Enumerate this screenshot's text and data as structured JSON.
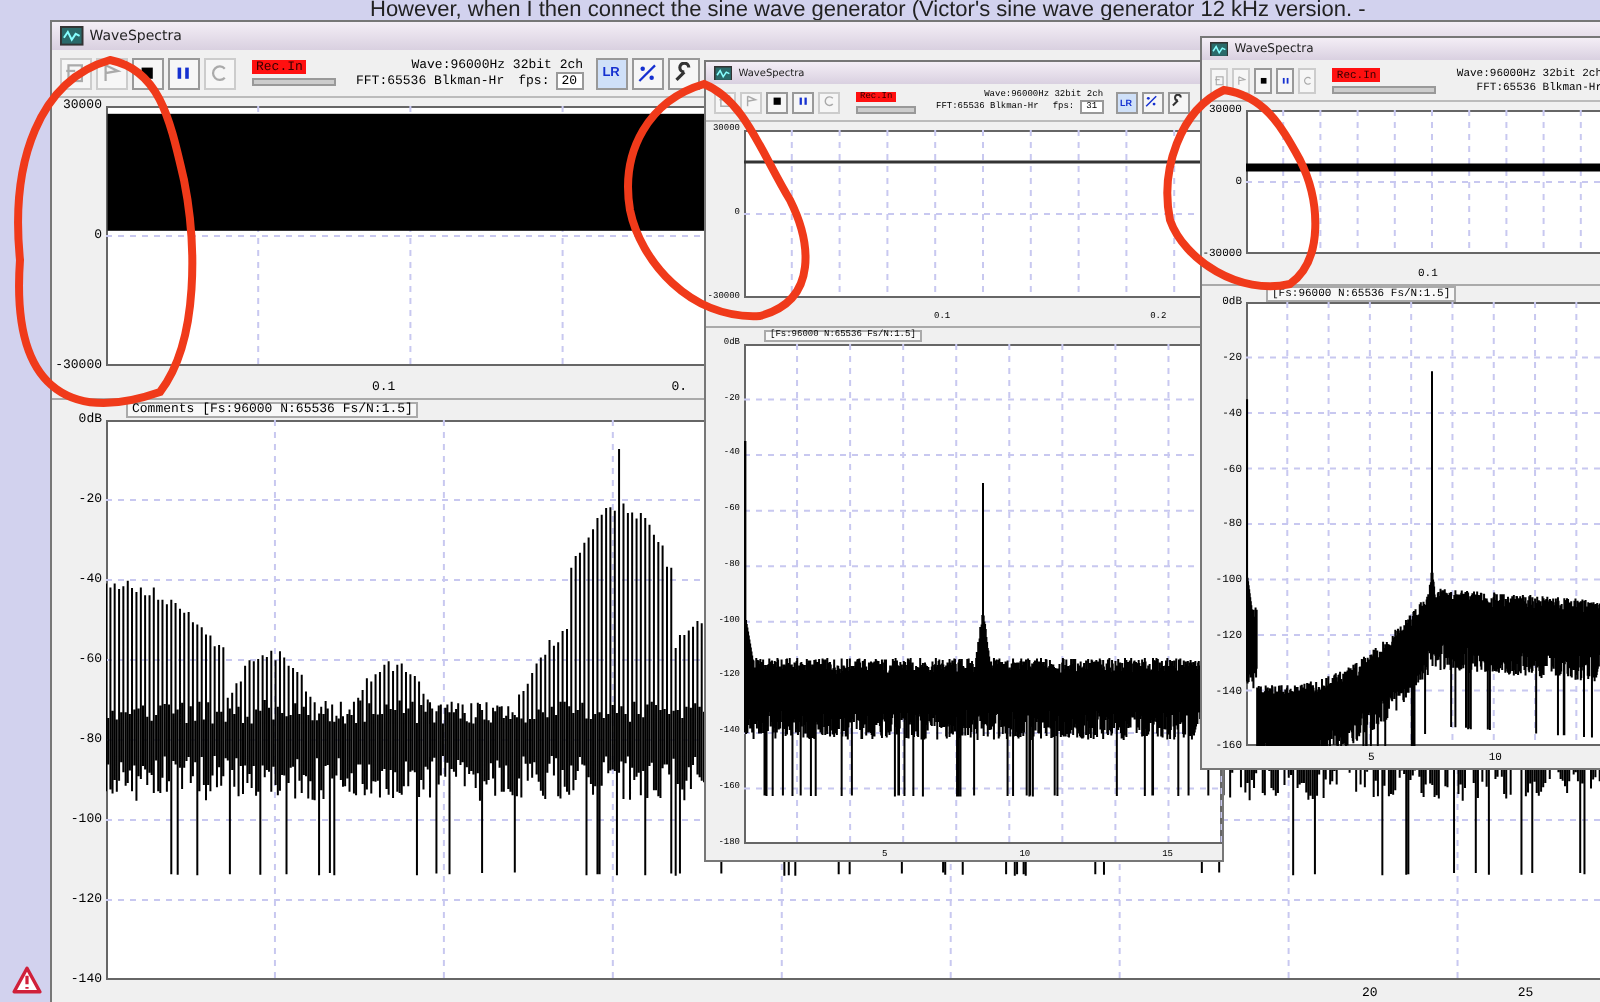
{
  "page_text": "However, when I then connect the sine wave generator (Victor's sine wave generator 12 kHz version. -",
  "windows": [
    {
      "title": "WaveSpectra",
      "rec_label": "Rec.In",
      "wave_info": "Wave:96000Hz 32bit 2ch",
      "fft_info": "FFT:65536 Blkman-Hr",
      "fps_label": "fps:",
      "fps_value": "20",
      "transport": [
        {
          "kind": "open",
          "disabled": true
        },
        {
          "kind": "play",
          "disabled": true
        },
        {
          "kind": "stop",
          "disabled": false
        },
        {
          "kind": "pause",
          "disabled": false
        },
        {
          "kind": "loop",
          "disabled": true
        }
      ],
      "tools": [
        {
          "kind": "channel",
          "label": "LR"
        },
        {
          "kind": "scatter"
        },
        {
          "kind": "wrench"
        }
      ],
      "wave": {
        "kind": "band",
        "y_ticks": [
          "30000",
          "0",
          "-30000"
        ],
        "x_ticks": [
          "0.1",
          "0."
        ]
      },
      "spectrum": {
        "kind": "lobed",
        "header": "Comments  [Fs:96000 N:65536 Fs/N:1.5]",
        "y_ticks": [
          "0dB",
          "-20",
          "-40",
          "-60",
          "-80",
          "-100",
          "-120",
          "-140"
        ],
        "x_ticks": [
          "20",
          "25"
        ]
      }
    },
    {
      "title": "WaveSpectra",
      "rec_label": "Rec.In",
      "wave_info": "Wave:96000Hz 32bit 2ch",
      "fft_info": "FFT:65536 Blkman-Hr",
      "fps_label": "fps:",
      "fps_value": "31",
      "transport": [
        {
          "kind": "open",
          "disabled": true
        },
        {
          "kind": "play",
          "disabled": true
        },
        {
          "kind": "stop",
          "disabled": false
        },
        {
          "kind": "pause",
          "disabled": false
        },
        {
          "kind": "loop",
          "disabled": true
        }
      ],
      "tools": [
        {
          "kind": "channel",
          "label": "LR"
        },
        {
          "kind": "scatter"
        },
        {
          "kind": "wrench"
        }
      ],
      "wave": {
        "kind": "line",
        "y_ticks": [
          "30000",
          "0",
          "-30000"
        ],
        "x_ticks": [
          "0.1",
          "0.2"
        ]
      },
      "spectrum": {
        "kind": "peak",
        "header": "[Fs:96000 N:65536 Fs/N:1.5]",
        "y_ticks": [
          "0dB",
          "-20",
          "-40",
          "-60",
          "-80",
          "-100",
          "-120",
          "-140",
          "-160",
          "-180"
        ],
        "x_ticks": [
          "5",
          "10",
          "15"
        ]
      }
    },
    {
      "title": "WaveSpectra",
      "rec_label": "Rec.In",
      "wave_info": "Wave:96000Hz 32bit 2ch",
      "fft_info": "FFT:65536 Blkman-Hr",
      "transport": [
        {
          "kind": "open",
          "disabled": true
        },
        {
          "kind": "play",
          "disabled": true
        },
        {
          "kind": "stop",
          "disabled": false
        },
        {
          "kind": "pause",
          "disabled": false
        },
        {
          "kind": "loop",
          "disabled": true
        }
      ],
      "wave": {
        "kind": "thick",
        "y_ticks": [
          "30000",
          "0",
          "-30000"
        ],
        "x_ticks": [
          "0.1"
        ]
      },
      "spectrum": {
        "kind": "peak-rising",
        "header": "[Fs:96000 N:65536 Fs/N:1.5]",
        "y_ticks": [
          "0dB",
          "-20",
          "-40",
          "-60",
          "-80",
          "-100",
          "-120",
          "-140",
          "-160"
        ],
        "x_ticks": [
          "5",
          "10"
        ]
      }
    }
  ]
}
